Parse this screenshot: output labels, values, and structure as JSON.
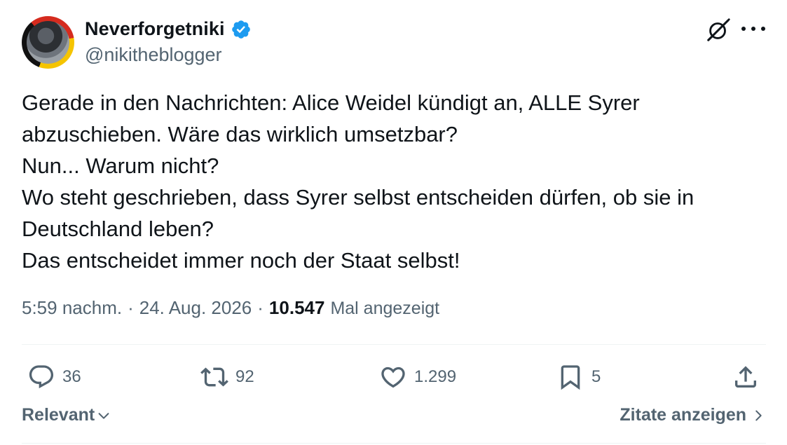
{
  "author": {
    "display_name": "Neverforgetniki",
    "handle": "@nikitheblogger",
    "verified": true
  },
  "icons": {
    "verified": "verified-badge-icon",
    "grok": "grok-icon",
    "more": "more-icon",
    "reply": "reply-icon",
    "retweet": "retweet-icon",
    "like": "heart-icon",
    "bookmark": "bookmark-icon",
    "share": "share-icon"
  },
  "colors": {
    "accent": "#1d9bf0",
    "text": "#0f1419",
    "secondary": "#536471",
    "divider": "#eff3f4"
  },
  "tweet": {
    "lines": [
      "Gerade in den Nachrichten: Alice Weidel kündigt an, ALLE Syrer",
      "abzuschieben. Wäre das wirklich umsetzbar?",
      "Nun... Warum nicht?",
      "Wo steht geschrieben, dass Syrer selbst entscheiden dürfen, ob sie in",
      "Deutschland leben?",
      "Das entscheidet immer noch der Staat selbst!"
    ]
  },
  "meta": {
    "time": "5:59 nachm.",
    "separator": "·",
    "date": "24. Aug. 2026",
    "views_count": "10.547",
    "views_label": "Mal angezeigt"
  },
  "actions": {
    "replies": "36",
    "retweets": "92",
    "likes": "1.299",
    "bookmarks": "5"
  },
  "footer": {
    "sort_label": "Relevant",
    "quotes_label": "Zitate anzeigen"
  }
}
